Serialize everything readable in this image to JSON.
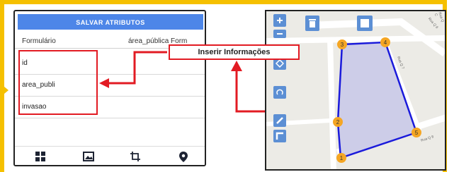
{
  "phone": {
    "save_button": "SALVAR ATRIBUTOS",
    "form_label": "Formulário",
    "form_value": "área_pública Form",
    "rows": [
      "id",
      "area_publi",
      "invasao"
    ]
  },
  "annotation": {
    "label": "Inserir Informações"
  },
  "map": {
    "vertices": [
      "1",
      "2",
      "3",
      "4",
      "5"
    ],
    "road_labels": [
      "Rua Q 7",
      "Rua Q 8",
      "Rua Q 6",
      "Rua Q C"
    ]
  },
  "colors": {
    "frame": "#f5c000",
    "accent": "#4d86e8",
    "annotation": "#e21b23",
    "polygon_fill": "#cdcde8",
    "polygon_stroke": "#1a1adb",
    "vertex": "#f5a623"
  },
  "icons": [
    "grid-icon",
    "image-icon",
    "crop-icon",
    "location-pin-icon",
    "plus-icon",
    "minus-icon",
    "polygon-icon",
    "undo-icon",
    "pencil-icon",
    "corner-icon",
    "trash-icon",
    "square-icon"
  ]
}
